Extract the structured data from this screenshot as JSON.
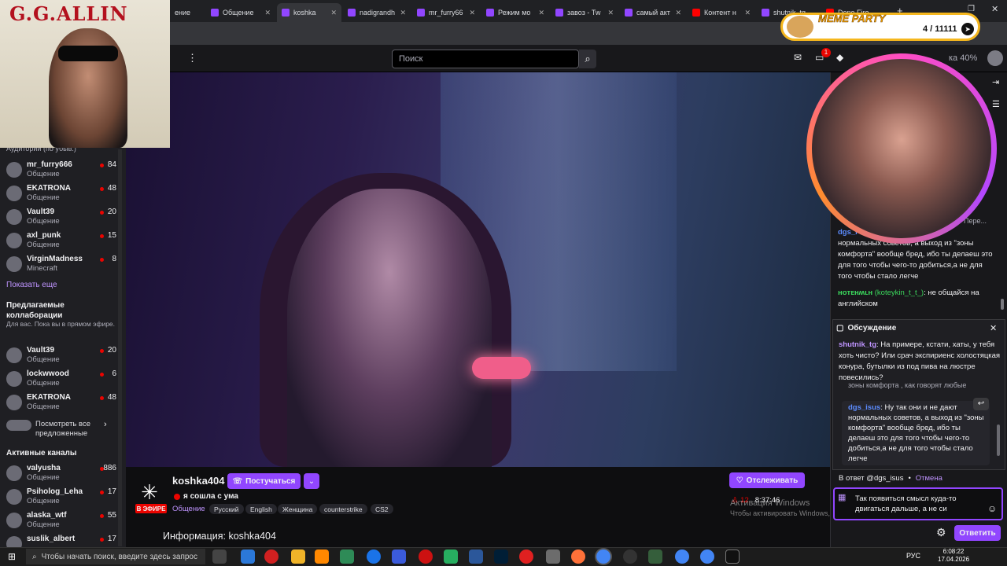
{
  "browser": {
    "tabs": [
      {
        "label": "ение"
      },
      {
        "label": "Общение"
      },
      {
        "label": "koshka"
      },
      {
        "label": "nadigrandh"
      },
      {
        "label": "mr_furry66"
      },
      {
        "label": "Режим мо"
      },
      {
        "label": "завоз - Tw"
      },
      {
        "label": "самый акт"
      },
      {
        "label": "Контент н"
      },
      {
        "label": "shutnik_tg"
      },
      {
        "label": "Done Fire"
      }
    ]
  },
  "overlay": {
    "allin_title": "G.G.ALLIN",
    "meme_title": "MEME PARTY",
    "meme_count": "4 / 11111"
  },
  "header": {
    "search_placeholder": "Поиск",
    "notif_badge": "1",
    "prime_text": "ка 40%"
  },
  "sidebar": {
    "audience_label": "Аудитории (по убыв.)",
    "followed": [
      {
        "name": "mr_furry666",
        "category": "Общение",
        "viewers": "84"
      },
      {
        "name": "EKATRONA",
        "category": "Общение",
        "viewers": "48"
      },
      {
        "name": "Vault39",
        "category": "Общение",
        "viewers": "20"
      },
      {
        "name": "axl_punk",
        "category": "Общение",
        "viewers": "15"
      },
      {
        "name": "VirginMadness",
        "category": "Minecraft",
        "viewers": "8"
      }
    ],
    "show_more": "Показать еще",
    "collab_title": "Предлагаемые коллаборации",
    "collab_sub": "Для вас. Пока вы в прямом эфире.",
    "collabs": [
      {
        "name": "Vault39",
        "category": "Общение",
        "viewers": "20"
      },
      {
        "name": "lockwwood",
        "category": "Общение",
        "viewers": "6"
      },
      {
        "name": "EKATRONA",
        "category": "Общение",
        "viewers": "48"
      }
    ],
    "see_all": "Посмотреть все предложенные",
    "active_title": "Активные каналы",
    "active": [
      {
        "name": "valyusha",
        "category": "Общение",
        "viewers": "886"
      },
      {
        "name": "Psiholog_Leha",
        "category": "Общение",
        "viewers": "17"
      },
      {
        "name": "alaska_wtf",
        "category": "Общение",
        "viewers": "55"
      },
      {
        "name": "suslik_albert",
        "category": "",
        "viewers": "17"
      }
    ]
  },
  "stream": {
    "channel": "koshka404",
    "knock_label": "Постучаться",
    "title": "я сошла с ума",
    "live_label": "В ЭФИРЕ",
    "category": "Общение",
    "tags": [
      "Русский",
      "English",
      "Женщина",
      "counterstrike",
      "CS2"
    ],
    "follow_label": "Отслеживать",
    "viewers": "12",
    "uptime": "8:37:46",
    "info_title": "Информация: koshka404"
  },
  "chat": {
    "truncated_top": "Пере...",
    "msg1_user": "dgs_i",
    "msg1_text": "нормальных советов, а выход из \"зоны комфорта\" вообще бред, ибо ты делаеш это для того чтобы чего-то добиться,а не для того чтобы стало легче",
    "msg2_user": "ʜᴏᴛᴇʜʍʟʜ",
    "msg2_login": "(koteykin_t_t_)",
    "msg2_text": ": не общайся на английском",
    "thread_title": "Обсуждение",
    "thread_user": "shutnik_tg",
    "thread_text": ": На примере, кстати, хаты, у тебя хоть чисто? Или срач экспириенс холостяцкая конура, бутылки из под пива на люстре повесились?",
    "thread_cut": "зоны комфорта , как говорят любые инфоцыгане",
    "reply_user": "dgs_isus",
    "reply_text": ": Ну так они и не дают нормальных советов, а выход из \"зоны комфорта\" вообще бред, ибо ты делаеш это для того чтобы чего-то добиться,а не для того чтобы стало легче",
    "reply_to": "В ответ @dgs_isus",
    "cancel": "Отмена",
    "input_value": "Так появиться смысл куда-то двигаться дальше, а не си",
    "send_label": "Ответить"
  },
  "windows": {
    "activation_line1": "Активация Windows",
    "activation_line2": "Чтобы активировать Windows, перейдите в раздел \"Параметры\".",
    "search_placeholder": "Чтобы начать поиск, введите здесь запрос",
    "lang": "РУС",
    "time": "6:08:22",
    "date": "17.04.2026"
  },
  "colors": {
    "accent": "#9146ff",
    "live": "#eb0400",
    "chat_bg": "#18181b"
  }
}
